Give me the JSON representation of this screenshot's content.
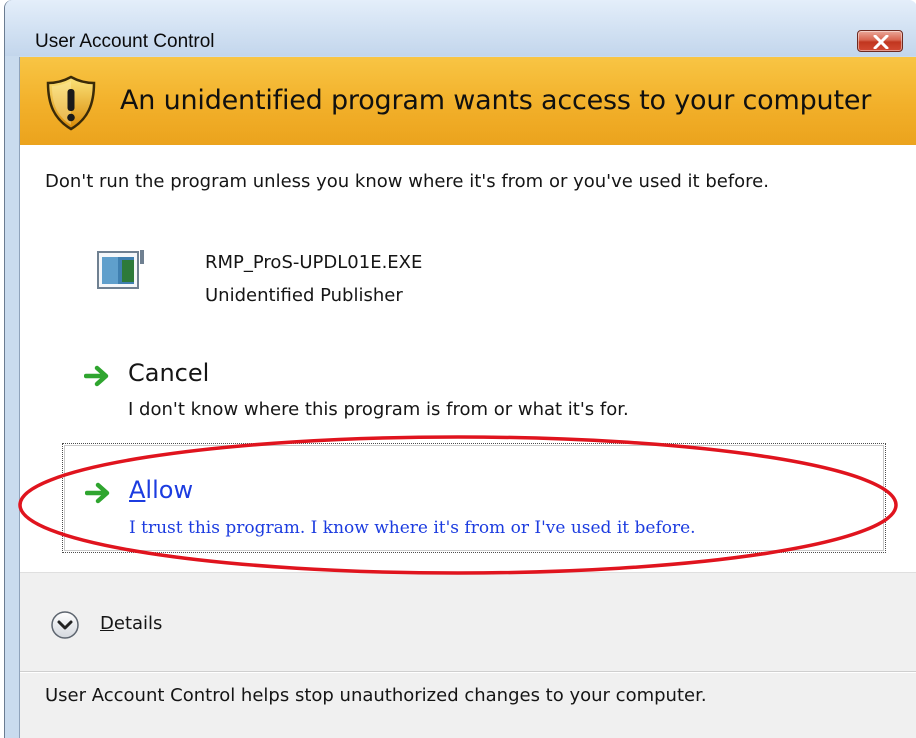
{
  "window": {
    "title": "User Account Control"
  },
  "banner": {
    "heading": "An unidentified program wants access to your computer"
  },
  "intro": {
    "text": "Don't run the program unless you know where it's from or you've used it before."
  },
  "program": {
    "name": "RMP_ProS-UPDL01E.EXE",
    "publisher": "Unidentified Publisher"
  },
  "options": {
    "cancel": {
      "title": "Cancel",
      "description": "I don't know where this program is from or what it's for."
    },
    "allow": {
      "title_accel": "A",
      "title_rest": "llow",
      "description": "I trust this program. I know where it's from or I've used it before."
    }
  },
  "details": {
    "accel": "D",
    "rest": "etails"
  },
  "footer": {
    "text": "User Account Control helps stop unauthorized changes to your computer."
  },
  "colors": {
    "banner": "#f2b02a",
    "link_blue": "#1c3ce0",
    "arrow_green": "#2fa52f",
    "annotation_red": "#e0141e",
    "close_red": "#c1361f"
  },
  "icons": {
    "shield": "uac-shield-icon",
    "program": "application-icon",
    "arrow": "green-arrow-icon",
    "details": "chevron-down-circle-icon",
    "close": "close-icon"
  }
}
